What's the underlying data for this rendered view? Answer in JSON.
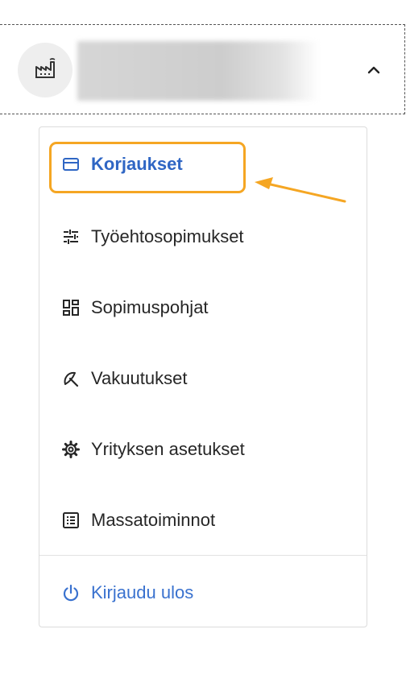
{
  "header": {
    "account_name": "",
    "company_icon": "factory-icon",
    "toggle_icon": "chevron-up-icon"
  },
  "menu": {
    "items": [
      {
        "label": "Korjaukset",
        "icon": "card-icon",
        "active": true
      },
      {
        "label": "Työehtosopimukset",
        "icon": "sliders-icon"
      },
      {
        "label": "Sopimuspohjat",
        "icon": "grid-icon"
      },
      {
        "label": "Vakuutukset",
        "icon": "umbrella-icon"
      },
      {
        "label": "Yrityksen asetukset",
        "icon": "gear-icon"
      },
      {
        "label": "Massatoiminnot",
        "icon": "list-icon"
      }
    ],
    "logout": {
      "label": "Kirjaudu ulos",
      "icon": "power-icon"
    }
  },
  "colors": {
    "accent": "#2f66c4",
    "highlight": "#f5a623",
    "text": "#262626",
    "border": "#dcdcdc"
  }
}
